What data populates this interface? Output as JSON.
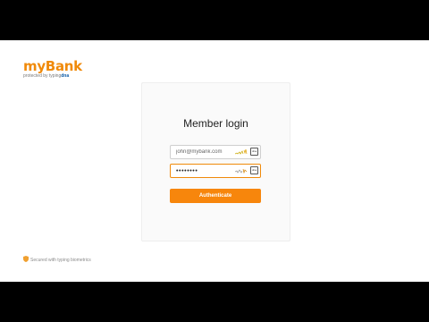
{
  "brand": {
    "name": "myBank",
    "protected_by": "protected by ",
    "provider_typing": "typing",
    "provider_dna": "dna"
  },
  "login": {
    "title": "Member login",
    "email_value": "john@mybank.com",
    "password_value": "••••••••",
    "dna_badge": "dna",
    "authenticate_label": "Authenticate"
  },
  "footer": {
    "secured_text": "Secured with typing biometrics"
  },
  "colors": {
    "accent": "#f7860c",
    "brand_blue": "#0b5aa6",
    "background": "#000000"
  }
}
